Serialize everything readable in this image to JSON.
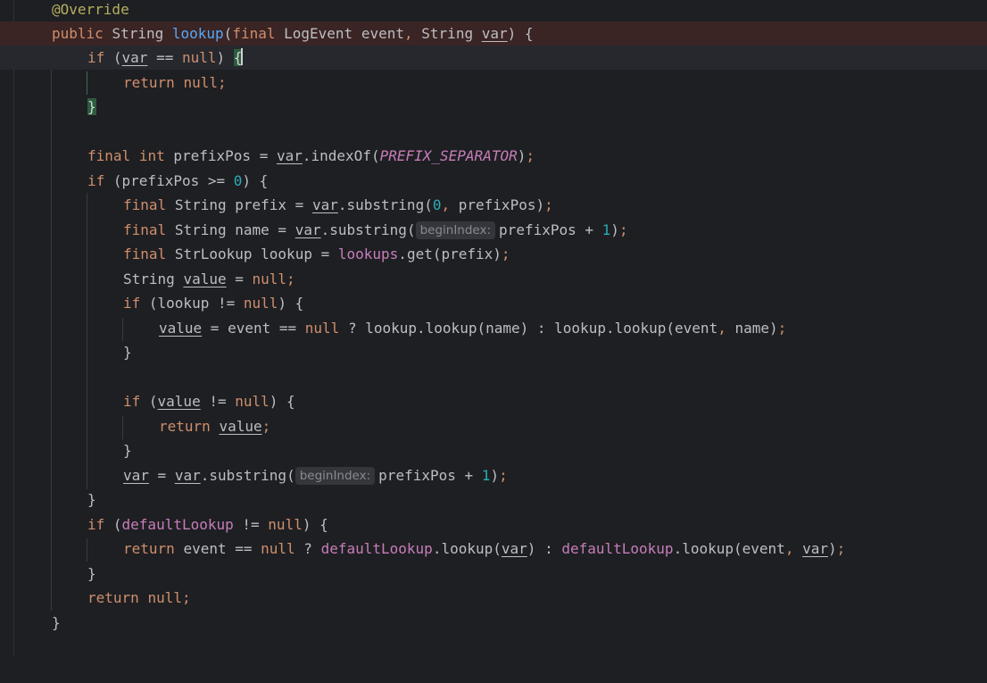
{
  "editor": {
    "language": "Java",
    "colors": {
      "background": "#1e1f22",
      "keyword": "#cf8e6d",
      "annotation": "#b3ae60",
      "method_declaration": "#56a8f5",
      "field": "#c77dbb",
      "number": "#2aacb8",
      "default_text": "#bcbec4",
      "highlighted_line": "#3a2424",
      "caret_line": "#26282e"
    },
    "inlay_hint": "beginIndex:",
    "code": {
      "l1_annotation": "@Override",
      "t_public": "public",
      "t_final": "final",
      "t_if": "if",
      "t_return": "return",
      "t_null": "null",
      "t_int": "int",
      "t_String": "String",
      "t_LogEvent": "LogEvent",
      "t_StrLookup": "StrLookup",
      "t_lookup": "lookup",
      "t_event": "event",
      "t_var": "var",
      "t_prefixPos": "prefixPos",
      "t_prefix": "prefix",
      "t_name": "name",
      "t_value": "value",
      "t_lookups": "lookups",
      "t_defaultLookup": "defaultLookup",
      "t_indexOf": "indexOf",
      "t_substring": "substring",
      "t_get": "get",
      "t_PREFIX_SEPARATOR": "PREFIX_SEPARATOR",
      "n0": "0",
      "n1": "1"
    }
  }
}
